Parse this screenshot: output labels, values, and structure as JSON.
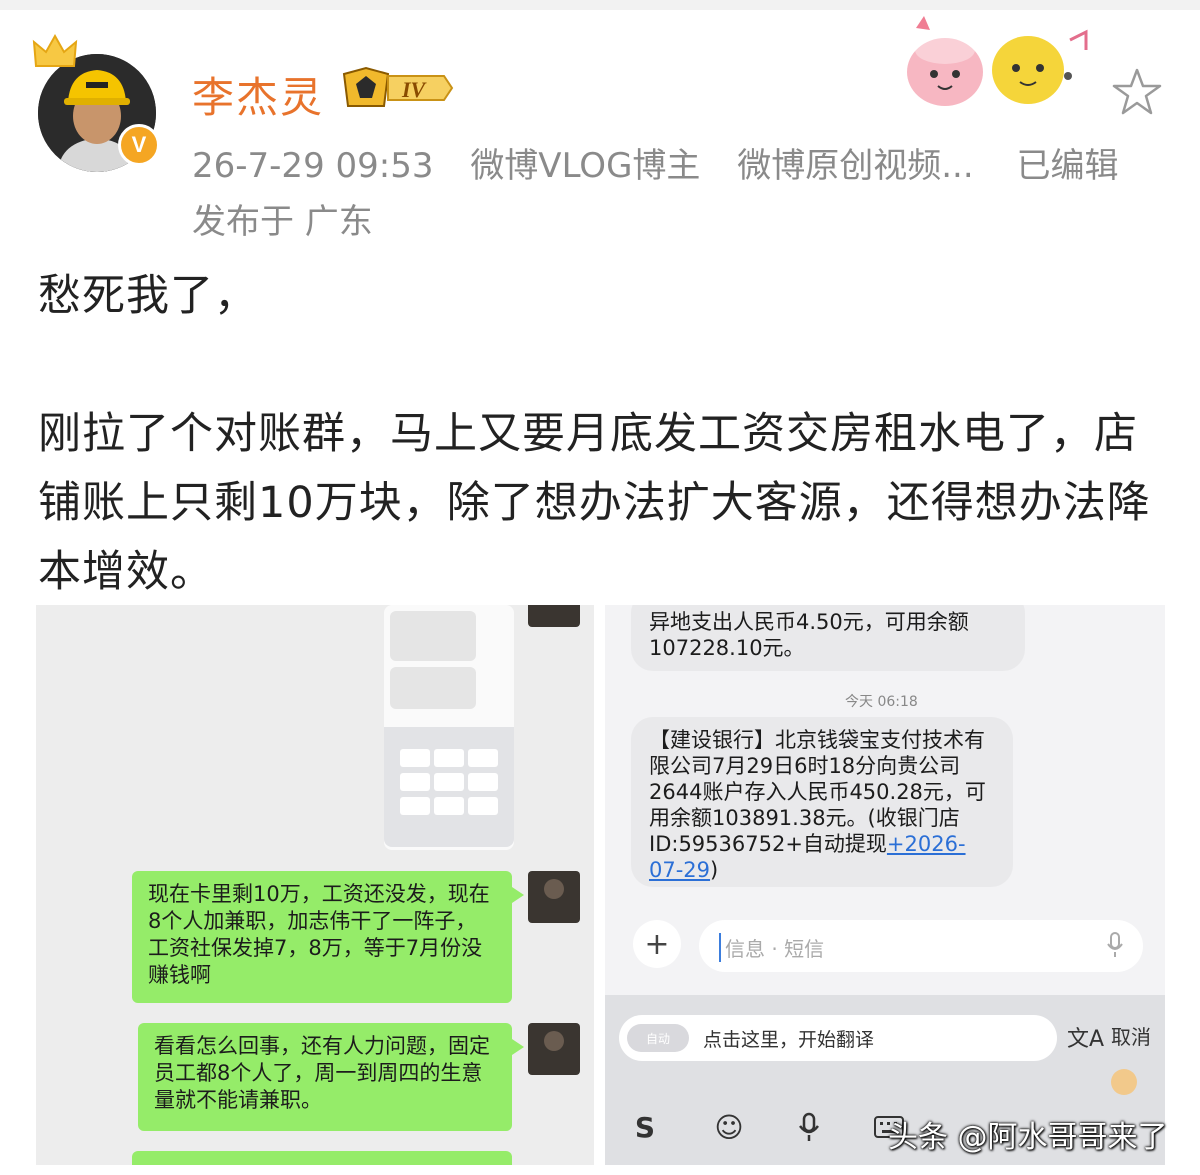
{
  "post": {
    "username": "李杰灵",
    "level": "IV",
    "timestamp": "26-7-29 09:53",
    "source_1": "微博VLOG博主",
    "source_2": "微博原创视频...",
    "edited": "已编辑",
    "location": "发布于 广东",
    "text_line_1": "愁死我了，",
    "text_paragraph_2": "刚拉了个对账群，马上又要月底发工资交房租水电了，店铺账上只剩10万块，除了想办法扩大客源，还得想办法降本增效。"
  },
  "left_screenshot": {
    "message_1": "现在卡里剩10万，工资还没发，现在8个人加兼职，加志伟干了一阵子，工资社保发掉7，8万，等于7月份没赚钱啊",
    "message_2": "看看怎么回事，还有人力问题，固定员工都8个人了，周一到周四的生意量就不能请兼职。"
  },
  "right_screenshot": {
    "sms_1": "异地支出人民币4.50元，可用余额107228.10元。",
    "time_label": "今天 06:18",
    "sms_2_body": "【建设银行】北京钱袋宝支付技术有限公司7月29日6时18分向贵公司2644账户存入人民币450.28元，可用余额103891.38元。(收银门店ID:59536752+自动提现",
    "sms_2_link": "+2026-07-29",
    "sms_2_end": ")",
    "input_placeholder": "信息 · 短信",
    "translate_hint": "点击这里，开始翻译",
    "translate_chip": "自动",
    "translate_icon": "文A",
    "cancel_label": "取消"
  },
  "watermark": "头条 @阿水哥哥来了",
  "colors": {
    "username": "#e8732c",
    "meta": "#8a8a8a",
    "wechat_green": "#95ec69",
    "sms_bubble": "#e9e9eb",
    "link": "#2b6fd6"
  }
}
